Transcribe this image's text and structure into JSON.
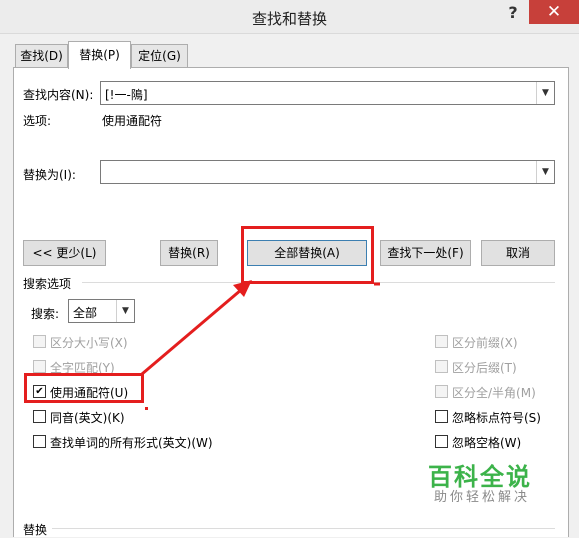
{
  "window": {
    "title": "查找和替换",
    "help": "?",
    "close": "✕"
  },
  "tabs": [
    {
      "label": "查找(D)"
    },
    {
      "label": "替换(P)"
    },
    {
      "label": "定位(G)"
    }
  ],
  "find": {
    "label": "查找内容(N):",
    "value": "[!一-隝]"
  },
  "options": {
    "label": "选项:",
    "value": "使用通配符"
  },
  "replace": {
    "label": "替换为(I):",
    "value": ""
  },
  "buttons": {
    "less": "<< 更少(L)",
    "replace": "替换(R)",
    "replace_all": "全部替换(A)",
    "find_next": "查找下一处(F)",
    "cancel": "取消"
  },
  "search_options": {
    "section_label": "搜索选项",
    "search_label": "搜索:",
    "search_value": "全部",
    "left": [
      {
        "label": "区分大小写(X)",
        "checked": false,
        "disabled": true
      },
      {
        "label": "全字匹配(Y)",
        "checked": false,
        "disabled": true
      },
      {
        "label": "使用通配符(U)",
        "checked": true,
        "disabled": false
      },
      {
        "label": "同音(英文)(K)",
        "checked": false,
        "disabled": false
      },
      {
        "label": "查找单词的所有形式(英文)(W)",
        "checked": false,
        "disabled": false
      }
    ],
    "right": [
      {
        "label": "区分前缀(X)",
        "checked": false,
        "disabled": true
      },
      {
        "label": "区分后缀(T)",
        "checked": false,
        "disabled": true
      },
      {
        "label": "区分全/半角(M)",
        "checked": false,
        "disabled": true
      },
      {
        "label": "忽略标点符号(S)",
        "checked": false,
        "disabled": false
      },
      {
        "label": "忽略空格(W)",
        "checked": false,
        "disabled": false
      }
    ]
  },
  "replace_section": {
    "label": "替换"
  },
  "watermark": {
    "brand": "百科全说",
    "tagline": "助你轻松解决"
  },
  "colors": {
    "highlight": "#e41e1e",
    "close": "#c7403a",
    "watermark": "#3cb34a"
  }
}
